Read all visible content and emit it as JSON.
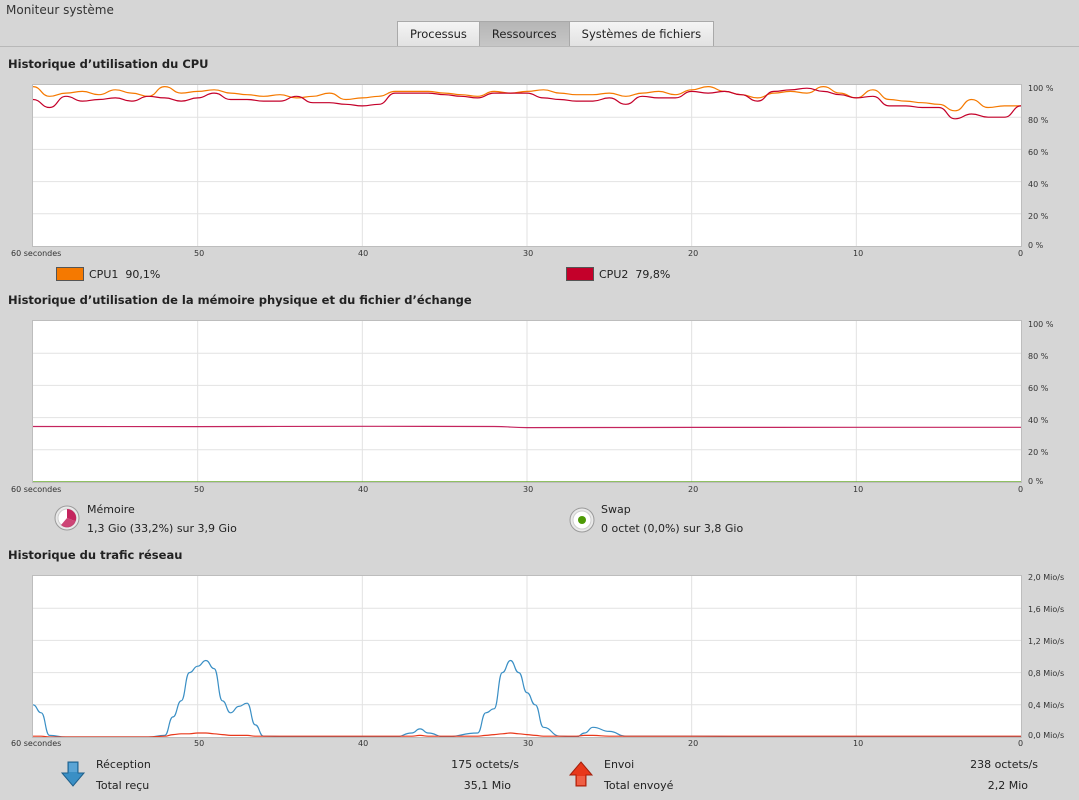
{
  "window": {
    "title": "Moniteur système"
  },
  "tabs": [
    {
      "label": "Processus",
      "active": false
    },
    {
      "label": "Ressources",
      "active": true
    },
    {
      "label": "Systèmes de fichiers",
      "active": false
    }
  ],
  "x_axis": {
    "labels": [
      "60 secondes",
      "50",
      "40",
      "30",
      "20",
      "10",
      "0"
    ]
  },
  "cpu": {
    "title": "Historique d’utilisation du CPU",
    "y_labels": [
      "100 %",
      "80 %",
      "60 %",
      "40 %",
      "20 %",
      "0 %"
    ],
    "legend": [
      {
        "name": "CPU1",
        "value": "90,1%",
        "color": "#f57900"
      },
      {
        "name": "CPU2",
        "value": "79,8%",
        "color": "#c4002a"
      }
    ]
  },
  "memory": {
    "title": "Historique d’utilisation de la mémoire physique et du fichier d’échange",
    "y_labels": [
      "100 %",
      "80 %",
      "60 %",
      "40 %",
      "20 %",
      "0 %"
    ],
    "mem_label": "Mémoire",
    "mem_value": "1,3 Gio (33,2%) sur 3,9 Gio",
    "mem_color": "#c4245e",
    "swap_label": "Swap",
    "swap_value": "0 octet (0,0%) sur 3,8 Gio",
    "swap_color": "#4e9a06"
  },
  "network": {
    "title": "Historique du trafic réseau",
    "y_labels": [
      "2,0 Mio/s",
      "1,6 Mio/s",
      "1,2 Mio/s",
      "0,8 Mio/s",
      "0,4 Mio/s",
      "0,0 Mio/s"
    ],
    "rx_label": "Réception",
    "rx_rate": "175 octets/s",
    "rx_total_label": "Total reçu",
    "rx_total": "35,1 Mio",
    "rx_color": "#3a8fc5",
    "tx_label": "Envoi",
    "tx_rate": "238 octets/s",
    "tx_total_label": "Total envoyé",
    "tx_total": "2,2 Mio",
    "tx_color": "#e8381b"
  },
  "chart_data": [
    {
      "type": "line",
      "title": "Historique d’utilisation du CPU",
      "x_unit": "seconds ago",
      "x": [
        60,
        59,
        58,
        57,
        56,
        55,
        54,
        53,
        52,
        51,
        50,
        49,
        48,
        47,
        46,
        45,
        44,
        43,
        42,
        41,
        40,
        39,
        38,
        37,
        36,
        35,
        34,
        33,
        32,
        31,
        30,
        29,
        28,
        27,
        26,
        25,
        24,
        23,
        22,
        21,
        20,
        19,
        18,
        17,
        16,
        15,
        14,
        13,
        12,
        11,
        10,
        9,
        8,
        7,
        6,
        5,
        4,
        3,
        2,
        1,
        0
      ],
      "ylim": [
        0,
        100
      ],
      "series": [
        {
          "name": "CPU1",
          "values": [
            99,
            93,
            95,
            96,
            94,
            97,
            95,
            93,
            99,
            95,
            96,
            97,
            95,
            94,
            93,
            94,
            92,
            93,
            95,
            91,
            92,
            93,
            96,
            96,
            96,
            95,
            94,
            93,
            96,
            95,
            96,
            97,
            95,
            94,
            94,
            95,
            93,
            95,
            96,
            94,
            97,
            99,
            96,
            94,
            92,
            95,
            96,
            95,
            99,
            95,
            92,
            97,
            91,
            90,
            89,
            88,
            84,
            91,
            86,
            87,
            87
          ]
        },
        {
          "name": "CPU2",
          "values": [
            91,
            86,
            93,
            90,
            91,
            92,
            90,
            93,
            92,
            90,
            92,
            95,
            91,
            91,
            90,
            90,
            93,
            89,
            89,
            88,
            87,
            88,
            95,
            95,
            95,
            94,
            93,
            92,
            95,
            95,
            95,
            92,
            91,
            90,
            90,
            92,
            88,
            93,
            92,
            92,
            96,
            95,
            96,
            94,
            90,
            96,
            97,
            98,
            96,
            94,
            92,
            93,
            87,
            87,
            86,
            86,
            79,
            82,
            80,
            80,
            87
          ]
        }
      ]
    },
    {
      "type": "line",
      "title": "Historique d’utilisation de la mémoire physique et du fichier d’échange",
      "x_unit": "seconds ago",
      "x": [
        60,
        50,
        40,
        32,
        30,
        20,
        10,
        0
      ],
      "ylim": [
        0,
        100
      ],
      "series": [
        {
          "name": "Mémoire",
          "values": [
            34.5,
            34.4,
            34.6,
            34.5,
            33.8,
            33.9,
            34.0,
            34.0
          ]
        },
        {
          "name": "Swap",
          "values": [
            0,
            0,
            0,
            0,
            0,
            0,
            0,
            0
          ]
        }
      ]
    },
    {
      "type": "line",
      "title": "Historique du trafic réseau",
      "x_unit": "seconds ago",
      "y_unit": "Mio/s",
      "x": [
        60,
        59.5,
        59,
        58,
        56,
        53,
        52,
        51.5,
        51,
        50.5,
        50,
        49.5,
        49,
        48.5,
        48,
        47.5,
        47,
        46.5,
        46,
        44,
        42,
        38,
        37,
        36.5,
        36,
        35,
        33,
        32.5,
        32,
        31.5,
        31,
        30.5,
        30,
        29.5,
        29,
        28,
        27,
        26.5,
        26,
        25,
        24,
        20,
        15,
        10,
        5,
        0
      ],
      "ylim": [
        0,
        2.0
      ],
      "series": [
        {
          "name": "Réception",
          "values": [
            0.4,
            0.3,
            0.02,
            0,
            0,
            0,
            0.02,
            0.25,
            0.45,
            0.8,
            0.88,
            0.95,
            0.85,
            0.45,
            0.3,
            0.38,
            0.42,
            0.15,
            0.01,
            0,
            0,
            0,
            0.05,
            0.1,
            0.05,
            0,
            0.05,
            0.3,
            0.35,
            0.8,
            0.95,
            0.8,
            0.55,
            0.4,
            0.12,
            0.01,
            0,
            0.05,
            0.12,
            0.07,
            0.01,
            0.01,
            0,
            0,
            0,
            0
          ]
        },
        {
          "name": "Envoi",
          "values": [
            0.01,
            0.01,
            0,
            0,
            0,
            0,
            0.01,
            0.03,
            0.04,
            0.04,
            0.05,
            0.05,
            0.04,
            0.03,
            0.02,
            0.02,
            0.02,
            0.01,
            0.01,
            0.01,
            0.01,
            0.01,
            0.01,
            0.02,
            0.01,
            0.01,
            0.01,
            0.02,
            0.03,
            0.04,
            0.05,
            0.04,
            0.03,
            0.02,
            0.01,
            0.01,
            0.01,
            0.02,
            0.02,
            0.01,
            0.01,
            0.01,
            0.01,
            0.01,
            0.01,
            0.01
          ]
        }
      ]
    }
  ]
}
